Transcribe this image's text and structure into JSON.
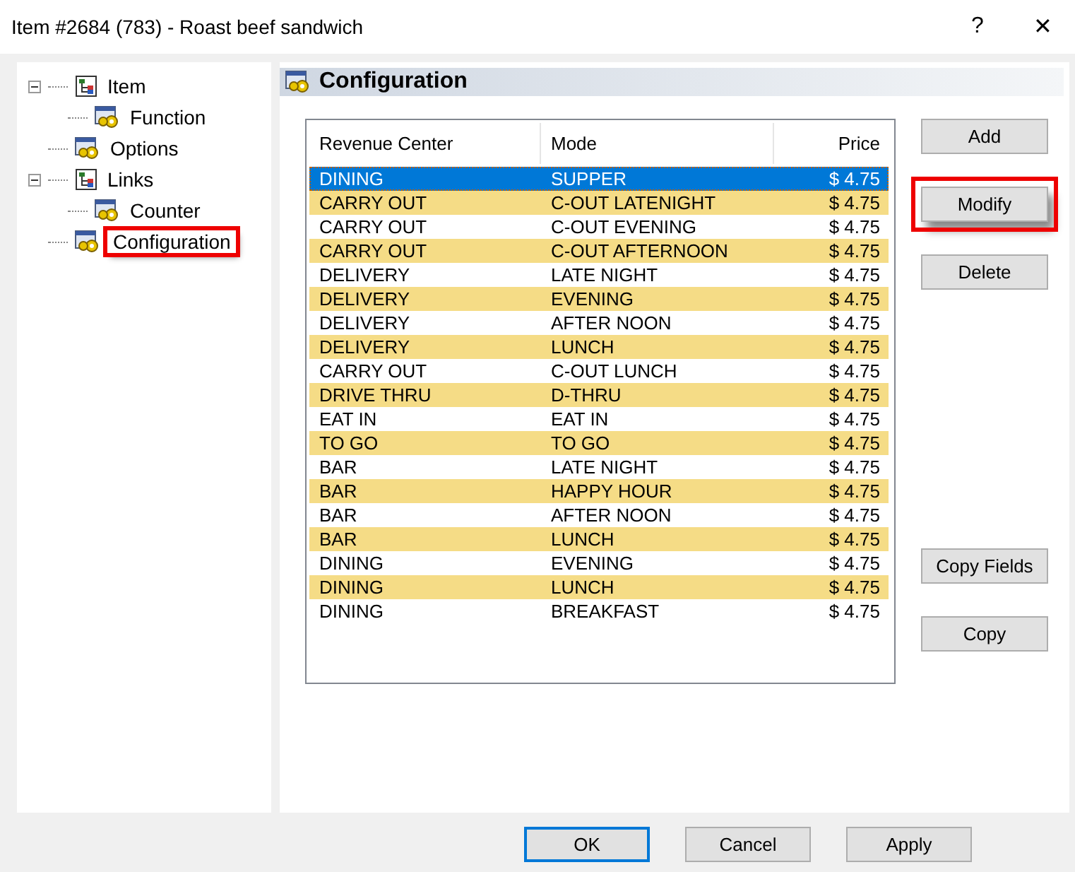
{
  "window": {
    "title": "Item #2684 (783) - Roast beef sandwich",
    "help": "?",
    "close": "✕"
  },
  "tree": [
    {
      "label": "Item",
      "kind": "tree",
      "expanded": true,
      "highlighted": false,
      "children": [
        {
          "label": "Function",
          "kind": "gear",
          "highlighted": false
        }
      ]
    },
    {
      "label": "Options",
      "kind": "gear",
      "highlighted": false
    },
    {
      "label": "Links",
      "kind": "tree",
      "expanded": true,
      "highlighted": false,
      "children": [
        {
          "label": "Counter",
          "kind": "gear",
          "highlighted": false
        }
      ]
    },
    {
      "label": "Configuration",
      "kind": "gear",
      "highlighted": true
    }
  ],
  "panel": {
    "title": "Configuration"
  },
  "table": {
    "columns": [
      "Revenue Center",
      "Mode",
      "Price"
    ],
    "rows": [
      {
        "cells": [
          "DINING",
          "SUPPER",
          "$ 4.75"
        ],
        "selected": true
      },
      {
        "cells": [
          "CARRY OUT",
          "C-OUT LATENIGHT",
          "$ 4.75"
        ],
        "selected": false,
        "shaded": true
      },
      {
        "cells": [
          "CARRY OUT",
          "C-OUT EVENING",
          "$ 4.75"
        ],
        "selected": false,
        "shaded": false
      },
      {
        "cells": [
          "CARRY OUT",
          "C-OUT AFTERNOON",
          "$ 4.75"
        ],
        "selected": false,
        "shaded": true
      },
      {
        "cells": [
          "DELIVERY",
          "LATE NIGHT",
          "$ 4.75"
        ],
        "selected": false,
        "shaded": false
      },
      {
        "cells": [
          "DELIVERY",
          "EVENING",
          "$ 4.75"
        ],
        "selected": false,
        "shaded": true
      },
      {
        "cells": [
          "DELIVERY",
          "AFTER NOON",
          "$ 4.75"
        ],
        "selected": false,
        "shaded": false
      },
      {
        "cells": [
          "DELIVERY",
          "LUNCH",
          "$ 4.75"
        ],
        "selected": false,
        "shaded": true
      },
      {
        "cells": [
          "CARRY OUT",
          "C-OUT LUNCH",
          "$ 4.75"
        ],
        "selected": false,
        "shaded": false
      },
      {
        "cells": [
          "DRIVE THRU",
          "D-THRU",
          "$ 4.75"
        ],
        "selected": false,
        "shaded": true
      },
      {
        "cells": [
          "EAT IN",
          "EAT IN",
          "$ 4.75"
        ],
        "selected": false,
        "shaded": false
      },
      {
        "cells": [
          "TO GO",
          "TO GO",
          "$ 4.75"
        ],
        "selected": false,
        "shaded": true
      },
      {
        "cells": [
          "BAR",
          "LATE NIGHT",
          "$ 4.75"
        ],
        "selected": false,
        "shaded": false
      },
      {
        "cells": [
          "BAR",
          "HAPPY HOUR",
          "$ 4.75"
        ],
        "selected": false,
        "shaded": true
      },
      {
        "cells": [
          "BAR",
          "AFTER NOON",
          "$ 4.75"
        ],
        "selected": false,
        "shaded": false
      },
      {
        "cells": [
          "BAR",
          "LUNCH",
          "$ 4.75"
        ],
        "selected": false,
        "shaded": true
      },
      {
        "cells": [
          "DINING",
          "EVENING",
          "$ 4.75"
        ],
        "selected": false,
        "shaded": false
      },
      {
        "cells": [
          "DINING",
          "LUNCH",
          "$ 4.75"
        ],
        "selected": false,
        "shaded": true
      },
      {
        "cells": [
          "DINING",
          "BREAKFAST",
          "$ 4.75"
        ],
        "selected": false,
        "shaded": false
      }
    ]
  },
  "side_buttons_top": [
    {
      "label": "Add",
      "highlighted": false
    },
    {
      "label": "Modify",
      "highlighted": true
    },
    {
      "label": "Delete",
      "highlighted": false
    }
  ],
  "side_buttons_bottom": [
    {
      "label": "Copy Fields",
      "highlighted": false
    },
    {
      "label": "Copy",
      "highlighted": false
    }
  ],
  "footer_buttons": [
    {
      "label": "OK",
      "default": true
    },
    {
      "label": "Cancel",
      "default": false
    },
    {
      "label": "Apply",
      "default": false
    }
  ]
}
